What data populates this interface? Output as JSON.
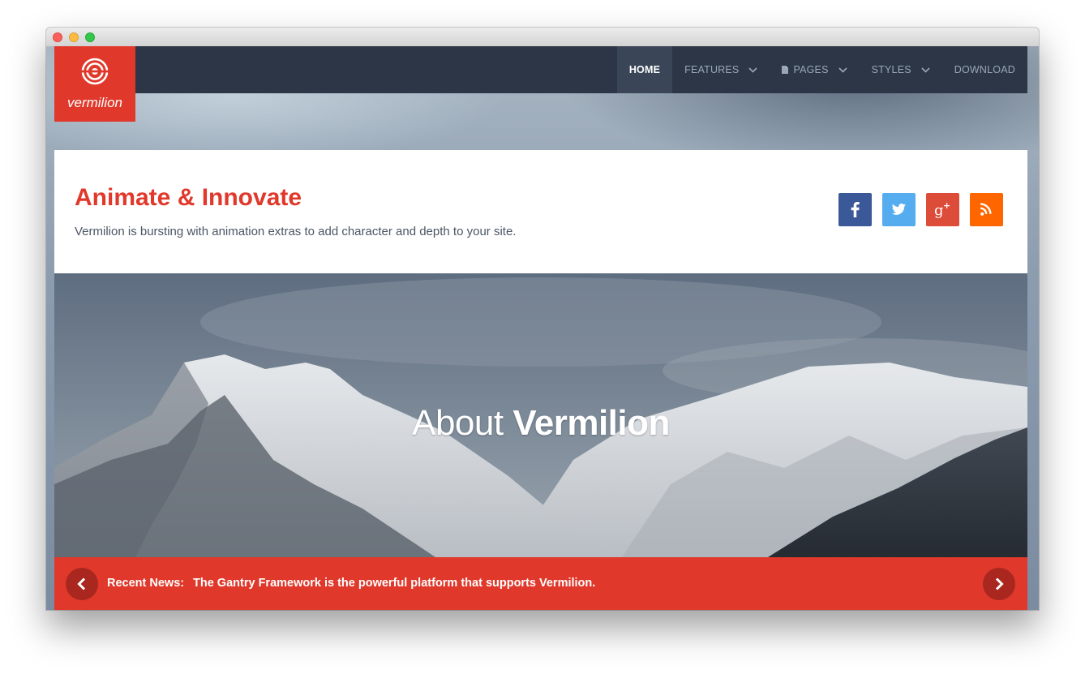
{
  "nav": {
    "items": [
      {
        "label": "HOME",
        "active": true,
        "dropdown": false
      },
      {
        "label": "FEATURES",
        "active": false,
        "dropdown": true
      },
      {
        "label": "PAGES",
        "active": false,
        "dropdown": true,
        "icon": "document-icon"
      },
      {
        "label": "STYLES",
        "active": false,
        "dropdown": true
      },
      {
        "label": "DOWNLOAD",
        "active": false,
        "dropdown": false
      }
    ]
  },
  "logo": {
    "text": "vermilion",
    "icon": "target-circle-icon"
  },
  "hero": {
    "title": "Animate & Innovate",
    "description": "Vermilion is bursting with animation extras to add character and depth to your site."
  },
  "social": [
    {
      "name": "facebook",
      "icon": "facebook-icon",
      "color": "#3b5998"
    },
    {
      "name": "twitter",
      "icon": "twitter-icon",
      "color": "#55acee"
    },
    {
      "name": "google-plus",
      "icon": "google-plus-icon",
      "color": "#dd4b39"
    },
    {
      "name": "rss",
      "icon": "rss-icon",
      "color": "#ff6600"
    }
  ],
  "banner": {
    "title_light": "About",
    "title_bold": "Vermilion"
  },
  "news": {
    "label": "Recent News:",
    "text": "The Gantry Framework is the powerful platform that supports Vermilion."
  },
  "colors": {
    "accent": "#e0382b",
    "navbar": "#2c3646",
    "nav_active": "#3a4657",
    "arrow_button": "#a9271e"
  }
}
